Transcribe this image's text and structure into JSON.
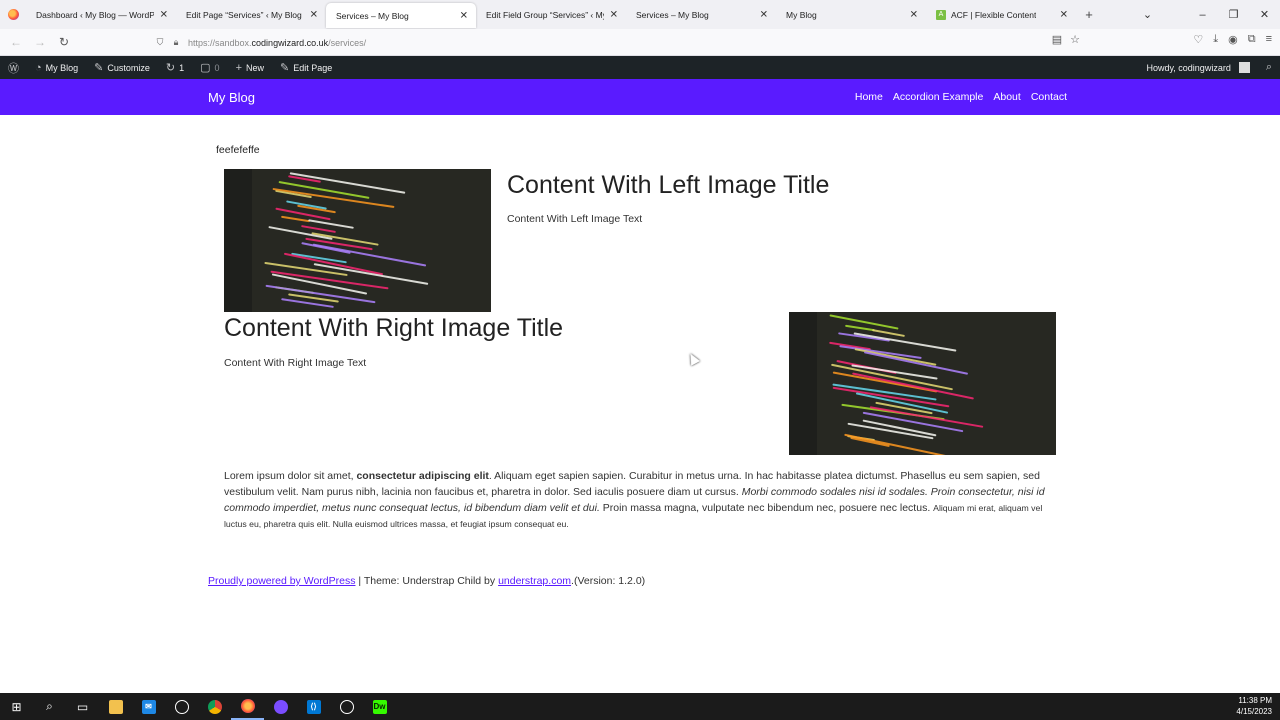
{
  "browser": {
    "tabs": [
      {
        "label": "Dashboard ‹ My Blog — WordPress",
        "active": false
      },
      {
        "label": "Edit Page “Services” ‹ My Blog — W",
        "active": false
      },
      {
        "label": "Services – My Blog",
        "active": true
      },
      {
        "label": "Edit Field Group “Services” ‹ My Blo",
        "active": false
      },
      {
        "label": "Services – My Blog",
        "active": false
      },
      {
        "label": "My Blog",
        "active": false
      },
      {
        "label": "ACF | Flexible Content",
        "active": false
      }
    ],
    "url_prefix": "https://sandbox.",
    "url_host": "codingwizard.co.uk",
    "url_path": "/services/"
  },
  "adminbar": {
    "site": "My Blog",
    "customize": "Customize",
    "updates": "1",
    "comments": "0",
    "new": "New",
    "edit": "Edit Page",
    "howdy": "Howdy, codingwizard"
  },
  "site": {
    "brand": "My Blog",
    "nav": [
      "Home",
      "Accordion Example",
      "About",
      "Contact"
    ]
  },
  "content": {
    "intro": "feefefeffe",
    "left_block": {
      "title": "Content With Left Image Title",
      "text": "Content With Left Image Text"
    },
    "right_block": {
      "title": "Content With Right Image Title",
      "text": "Content With Right Image Text"
    },
    "lorem": {
      "p1": "Lorem ipsum dolor sit amet, ",
      "bold": "consectetur adipiscing elit",
      "p2": ". Aliquam eget sapien sapien. Curabitur in metus urna. In hac habitasse platea dictumst. Phasellus eu sem sapien, sed vestibulum velit. Nam purus nibh, lacinia non faucibus et, pharetra in dolor. Sed iaculis posuere diam ut cursus. ",
      "italic": "Morbi commodo sodales nisi id sodales. Proin consectetur, nisi id commodo imperdiet, metus nunc consequat lectus, id bibendum diam velit et dui.",
      "p3": " Proin massa magna, vulputate nec bibendum nec, posuere nec lectus. ",
      "small": "Aliquam mi erat, aliquam vel luctus eu, pharetra quis elit. Nulla euismod ultrices massa, et feugiat ipsum consequat eu."
    }
  },
  "footer": {
    "powered": "Proudly powered by WordPress",
    "sep": " | Theme: Understrap Child by ",
    "link": "understrap.com",
    "version": ".(Version: 1.2.0)"
  },
  "taskbar": {
    "time": "11:38 PM",
    "date": "4/15/2023"
  },
  "colors": {
    "brand": "#5a1bff",
    "adminbar": "#1d2327"
  }
}
